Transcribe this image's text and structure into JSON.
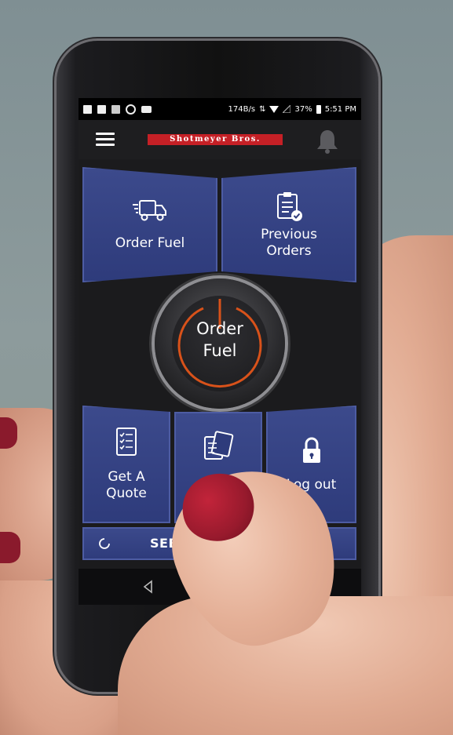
{
  "status_bar": {
    "network_speed": "174B/s",
    "battery": "37%",
    "time": "5:51 PM"
  },
  "app_bar": {
    "logo_text": "Shotmeyer Bros.",
    "menu_icon": "hamburger-menu-icon",
    "notification_icon": "bell-icon"
  },
  "tiles": {
    "order_fuel": "Order Fuel",
    "previous_orders_line1": "Previous",
    "previous_orders_line2": "Orders",
    "get_quote_line1": "Get A",
    "get_quote_line2": "Quote",
    "log_out": "Log out"
  },
  "power_button": {
    "line1": "Order",
    "line2": "Fuel"
  },
  "bottom_bar": {
    "label": "SEE TO"
  },
  "colors": {
    "tile_blue": "#2e3b7b",
    "accent_orange": "#d8521a",
    "logo_red": "#c52026"
  }
}
